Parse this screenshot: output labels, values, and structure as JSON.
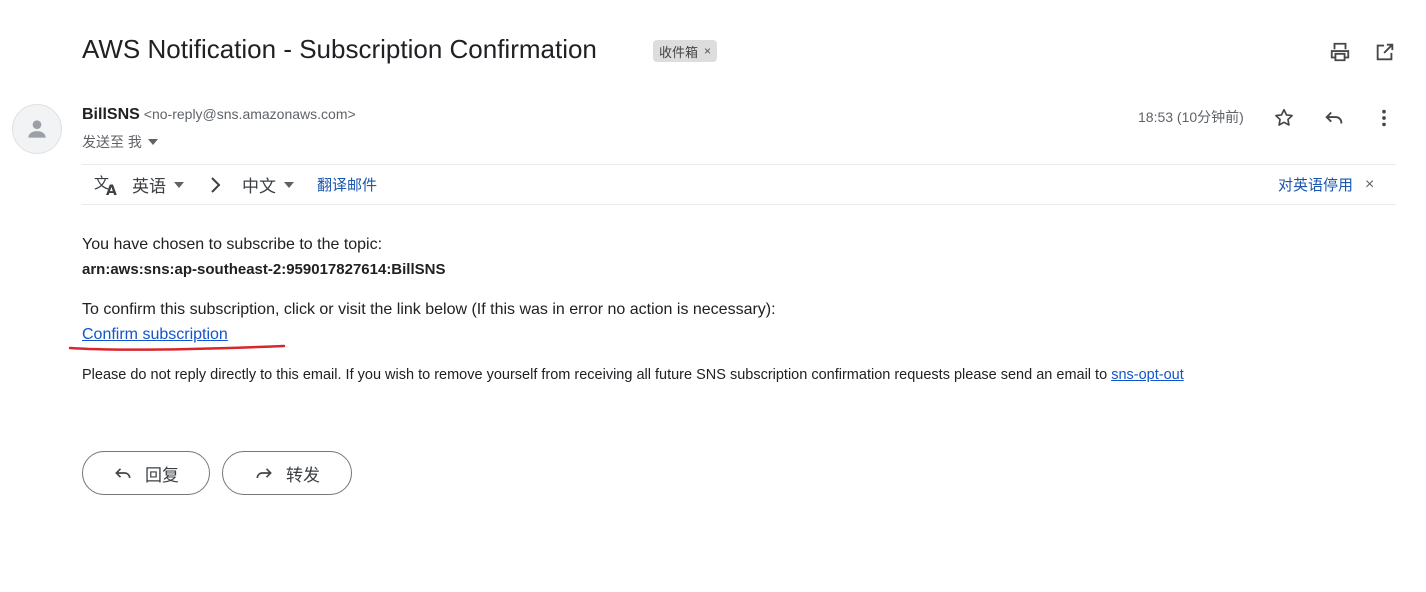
{
  "email": {
    "subject": "AWS Notification - Subscription Confirmation",
    "label": "收件箱",
    "label_remove": "×",
    "sender_name": "BillSNS",
    "sender_email": "<no-reply@sns.amazonaws.com>",
    "recipient": "发送至 我",
    "timestamp": "18:53 (10分钟前)"
  },
  "translate": {
    "source_lang": "英语",
    "target_lang": "中文",
    "translate_link": "翻译邮件",
    "disable_link": "对英语停用",
    "close": "×"
  },
  "body": {
    "line1": "You have chosen to subscribe to the topic:",
    "arn": "arn:aws:sns:ap-southeast-2:959017827614:BillSNS",
    "line2": "To confirm this subscription, click or visit the link below (If this was in error no action is necessary):",
    "confirm_link": "Confirm subscription",
    "footer_text": "Please do not reply directly to this email. If you wish to remove yourself from receiving all future SNS subscription confirmation requests please send an email to ",
    "opt_out_link": "sns-opt-out"
  },
  "actions": {
    "reply": "回复",
    "forward": "转发"
  },
  "icons": [
    "print-icon",
    "open-new-window-icon",
    "star-icon",
    "reply-icon",
    "more-vert-icon",
    "translate-icon",
    "chevron-right-icon",
    "dropdown-icon",
    "avatar-person-icon",
    "forward-icon"
  ],
  "colors": {
    "link": "#1155cc",
    "annotation": "#d8262c"
  }
}
